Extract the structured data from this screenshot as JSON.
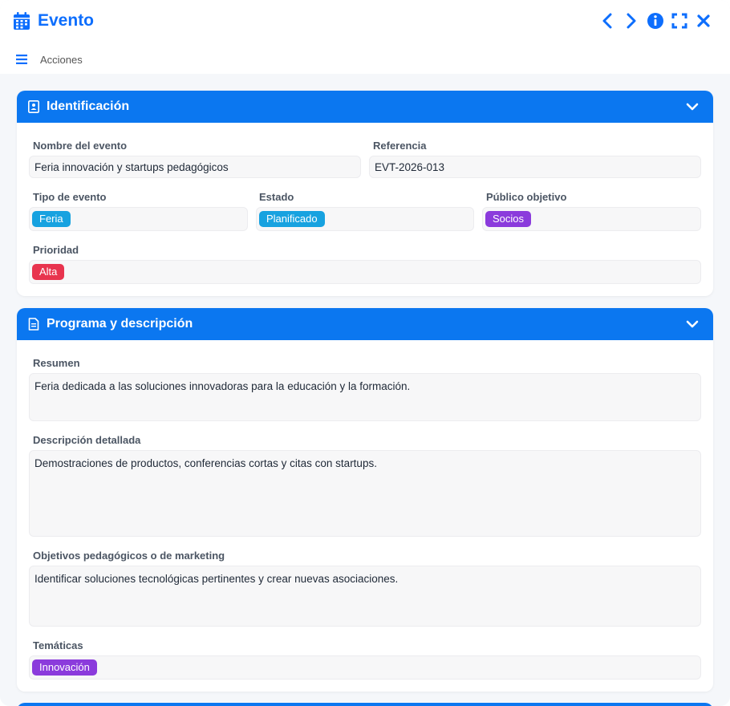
{
  "window": {
    "title": "Evento",
    "menu_label": "Acciones",
    "icons": [
      "calendar-icon",
      "chevron-left-icon",
      "chevron-right-icon",
      "info-icon",
      "fullscreen-icon",
      "close-icon",
      "hamburger-icon"
    ]
  },
  "colors": {
    "accent": "#0b77f0",
    "title": "#0d6efd",
    "chip_feria": "#17a2e0",
    "chip_planificado": "#17a2e0",
    "chip_socios": "#8b3bdc",
    "chip_alta": "#e8344e",
    "chip_innovacion": "#8b3bdc"
  },
  "identificacion": {
    "title": "Identificación",
    "nombre_label": "Nombre del evento",
    "nombre_value": "Feria innovación y startups pedagógicos",
    "referencia_label": "Referencia",
    "referencia_value": "EVT-2026-013",
    "tipo_label": "Tipo de evento",
    "tipo_value": "Feria",
    "estado_label": "Estado",
    "estado_value": "Planificado",
    "publico_label": "Público objetivo",
    "publico_value": "Socios",
    "prioridad_label": "Prioridad",
    "prioridad_value": "Alta"
  },
  "programa": {
    "title": "Programa y descripción",
    "resumen_label": "Resumen",
    "resumen_value": "Feria dedicada a las soluciones innovadoras para la educación y la formación.",
    "descripcion_label": "Descripción detallada",
    "descripcion_value": "Demostraciones de productos, conferencias cortas y citas con startups.",
    "objetivos_label": "Objetivos pedagógicos o de marketing",
    "objetivos_value": "Identificar soluciones tecnológicas pertinentes y crear nuevas asociaciones.",
    "tematicas_label": "Temáticas",
    "tematicas_value": "Innovación"
  }
}
